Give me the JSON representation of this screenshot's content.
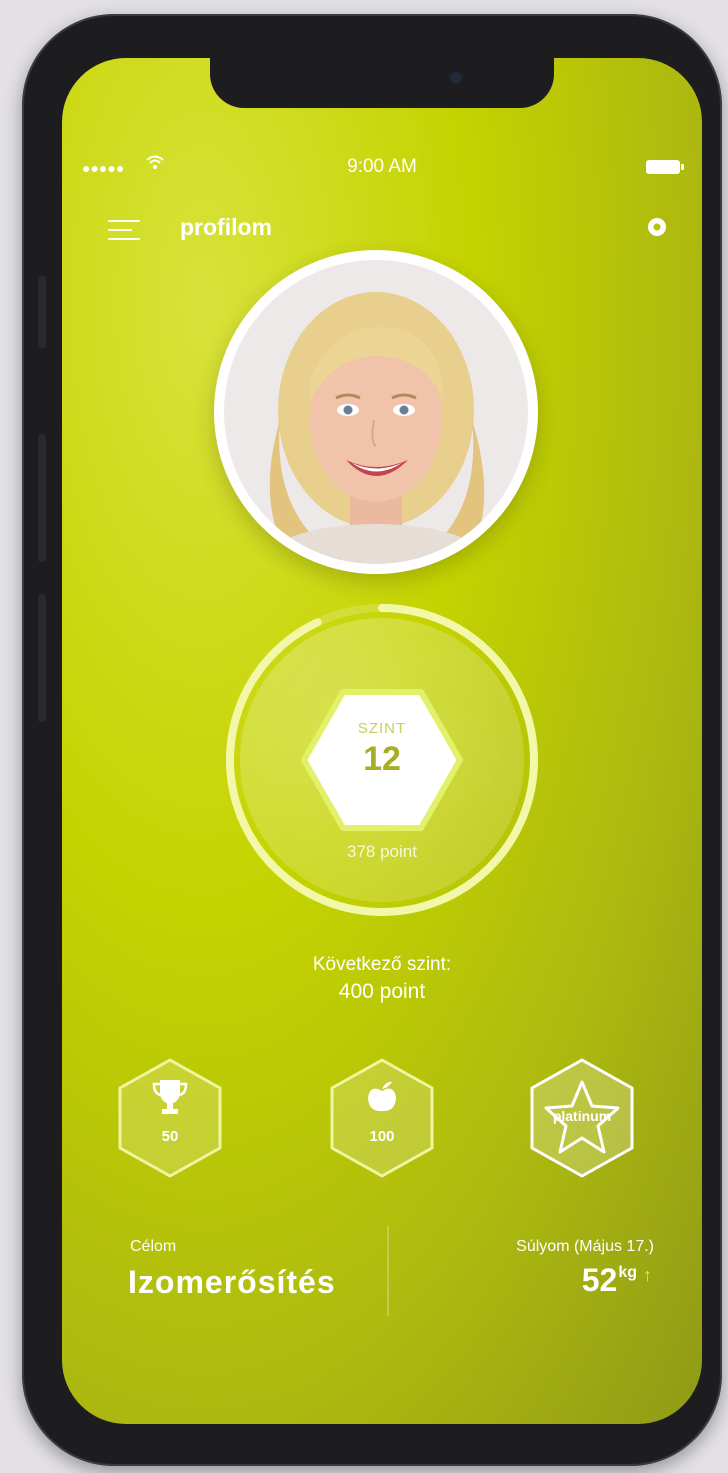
{
  "status_bar": {
    "signal": "●●●●●",
    "time": "9:00 AM"
  },
  "header": {
    "title": "profilom"
  },
  "level": {
    "label": "SZINT",
    "value": "12",
    "points": "378 point",
    "progress": 0.93
  },
  "next_level": {
    "label": "Következő szint:",
    "value": "400 point"
  },
  "badges": [
    {
      "icon": "trophy-icon",
      "label": "50"
    },
    {
      "icon": "apple-icon",
      "label": "100"
    },
    {
      "icon": "star-icon",
      "label": "platinum"
    }
  ],
  "goal": {
    "label": "Célom",
    "value": "Izomerősítés"
  },
  "weight": {
    "label": "Súlyom (Május 17.)",
    "value": "52",
    "unit": "kg",
    "trend": "up"
  },
  "colors": {
    "accent": "#c4d300",
    "ring": "#f0f7a0",
    "hexagon": "#ffffff"
  }
}
